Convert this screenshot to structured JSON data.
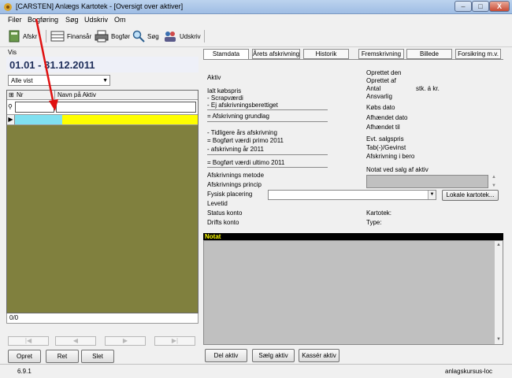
{
  "window": {
    "title": "[CARSTEN] Anlægs Kartotek - [Oversigt over aktiver]",
    "min": "–",
    "max": "□",
    "close": "X"
  },
  "menu": [
    "Filer",
    "Bogføring",
    "Søg",
    "Udskriv",
    "Om"
  ],
  "toolbar": {
    "afskriv": "Afskr",
    "finansaar": "Finansår",
    "bogfoer": "Bogfør",
    "soeg": "Søg",
    "udskriv": "Udskriv"
  },
  "left": {
    "vis_label": "Vis",
    "period": "01.01 - 31.12.2011",
    "filter": "Alle vist",
    "col_nr": "Nr",
    "col_navn": "Navn på Aktiv",
    "row_marker": "▶",
    "counter": "0/0",
    "nav": [
      "|◀",
      "◀",
      "▶",
      "▶|"
    ],
    "buttons": {
      "opret": "Opret",
      "ret": "Ret",
      "slet": "Slet"
    }
  },
  "tabs": [
    "Stamdata",
    "Årets afskrivning",
    "Historik",
    "Fremskrivning",
    "Billede",
    "Forsikring m.v."
  ],
  "stamdata": {
    "aktiv": "Aktiv",
    "kobspris": "Ialt købspris",
    "scrapvaerdi": "- Scrapværdi",
    "ej_afskr": "- Ej afskrivningsberettiget",
    "afskr_grundlag": "= Afskrivning grundlag",
    "tidl_afskr": "- Tidligere års afskrivning",
    "bogfort_primo": "= Bogført værdi primo  2011",
    "afskr_aar": "- afskrivning år  2011",
    "bogfort_ultimo": "= Bogført værdi ultimo  2011",
    "afskr_metode": "Afskrivnings metode",
    "afskr_princip": "Afskrivnings princip",
    "fysisk": "Fysisk placering",
    "levetid": "Levetid",
    "status_konto": "Status konto",
    "drifts_konto": "Drifts konto",
    "oprettet_den": "Oprettet den",
    "oprettet_af": "Oprettet af",
    "antal": "Antal",
    "stk": "stk. á kr.",
    "ansvarlig": "Ansvarlig",
    "kobs_dato": "Købs dato",
    "afhaendet_dato": "Afhændet dato",
    "afhaendet_til": "Afhændet til",
    "salgspris": "Evt. salgspris",
    "tab_gevinst": "Tab(-)/Gevinst",
    "afskr_bero": "Afskrivning i bero",
    "notat_salg": "Notat ved salg af aktiv",
    "kartotek": "Kartotek:",
    "type": "Type:",
    "lokale_btn": "Lokale kartotek..."
  },
  "notat": {
    "header": "Notat"
  },
  "bottom_buttons": {
    "del": "Del aktiv",
    "saelg": "Sælg aktiv",
    "kasser": "Kassér aktiv"
  },
  "statusbar": {
    "version": "6.9.1",
    "db": "anlagskursus-loc"
  }
}
